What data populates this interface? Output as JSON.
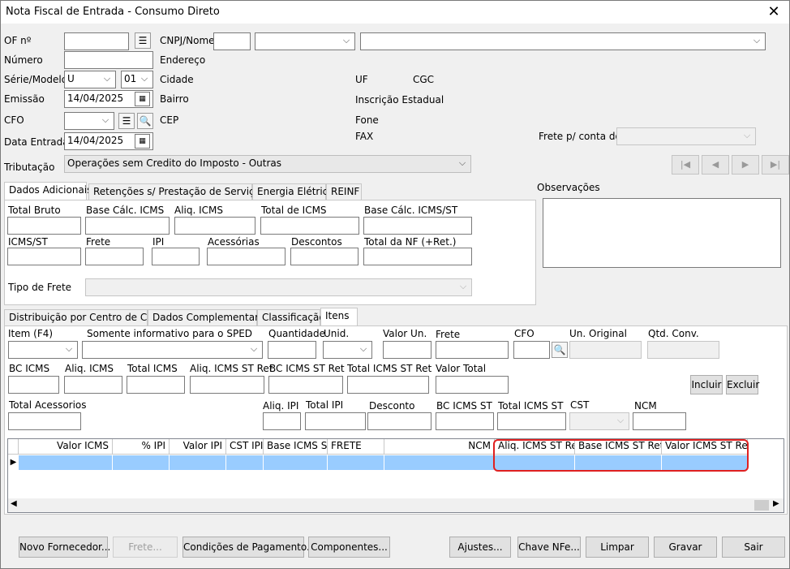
{
  "window": {
    "title": "Nota Fiscal de Entrada - Consumo Direto",
    "close": "✕"
  },
  "header": {
    "of_label": "OF nº",
    "of_value": "",
    "numero_label": "Número",
    "numero_value": "",
    "serie_label": "Série/Modelo",
    "serie_value": "U",
    "modelo_value": "01",
    "emissao_label": "Emissão",
    "emissao_value": "14/04/2025",
    "cfo_label": "CFO",
    "cfo_value": "",
    "data_entrada_label": "Data Entrada",
    "data_entrada_value": "14/04/2025",
    "tributacao_label": "Tributação",
    "tributacao_value": "Operações sem Credito do Imposto - Outras",
    "cnpj_label": "CNPJ/Nome",
    "endereco_label": "Endereço",
    "cidade_label": "Cidade",
    "bairro_label": "Bairro",
    "cep_label": "CEP",
    "uf_label": "UF",
    "cgc_label": "CGC",
    "ie_label": "Inscrição Estadual",
    "fone_label": "Fone",
    "fax_label": "FAX",
    "frete_conta_label": "Frete p/ conta do"
  },
  "nav": {
    "first": "|◀",
    "prev": "◀",
    "next": "▶",
    "last": "▶|"
  },
  "tabs_top": [
    "Dados Adicionais",
    "Retenções s/ Prestação de Serviços",
    "Energia Elétrica",
    "REINF"
  ],
  "dados_adicionais": {
    "total_bruto": "Total Bruto",
    "base_icms": "Base Cálc. ICMS",
    "aliq_icms": "Aliq. ICMS",
    "total_icms": "Total de ICMS",
    "base_icms_st": "Base Cálc. ICMS/ST",
    "icms_st": "ICMS/ST",
    "frete": "Frete",
    "ipi": "IPI",
    "acessorias": "Acessórias",
    "descontos": "Descontos",
    "total_nf": "Total da NF (+Ret.)",
    "tipo_frete": "Tipo de Frete"
  },
  "observacoes_label": "Observações",
  "tabs_bottom": [
    "Distribuição por Centro de Custo",
    "Dados Complementares",
    "Classificação",
    "Itens"
  ],
  "itens": {
    "item": "Item (F4)",
    "somente": "Somente informativo para o SPED",
    "quantidade": "Quantidade",
    "unid": "Unid.",
    "valor_un": "Valor Un.",
    "frete": "Frete",
    "cfo": "CFO",
    "un_original": "Un. Original",
    "qtd_conv": "Qtd. Conv.",
    "bc_icms": "BC ICMS",
    "aliq_icms": "Aliq. ICMS",
    "total_icms": "Total ICMS",
    "aliq_icms_st_ret": "Aliq. ICMS ST Ret",
    "bc_icms_st_ret": "BC ICMS ST Ret",
    "total_icms_st_ret": "Total ICMS ST Ret",
    "valor_total": "Valor Total",
    "total_acessorios": "Total Acessorios",
    "aliq_ipi": "Aliq. IPI",
    "total_ipi": "Total IPI",
    "desconto": "Desconto",
    "bc_icms_st": "BC ICMS ST",
    "total_icms_st": "Total ICMS ST",
    "cst": "CST",
    "ncm": "NCM",
    "incluir": "Incluir",
    "excluir": "Excluir"
  },
  "grid": {
    "columns": [
      "Valor ICMS",
      "% IPI",
      "Valor IPI",
      "CST IPI",
      "Base ICMS ST",
      "FRETE",
      "NCM",
      "Aliq. ICMS ST Ret",
      "Base ICMS ST Ret",
      "Valor ICMS ST Ret"
    ]
  },
  "buttons": {
    "novo_fornecedor": "Novo Fornecedor...",
    "frete": "Frete...",
    "condicoes": "Condições de Pagamento...",
    "componentes": "Componentes...",
    "ajustes": "Ajustes...",
    "chave": "Chave NFe...",
    "limpar": "Limpar",
    "gravar": "Gravar",
    "sair": "Sair"
  },
  "colors": {
    "selected_row": "#99ccff",
    "highlight": "#e02020"
  }
}
